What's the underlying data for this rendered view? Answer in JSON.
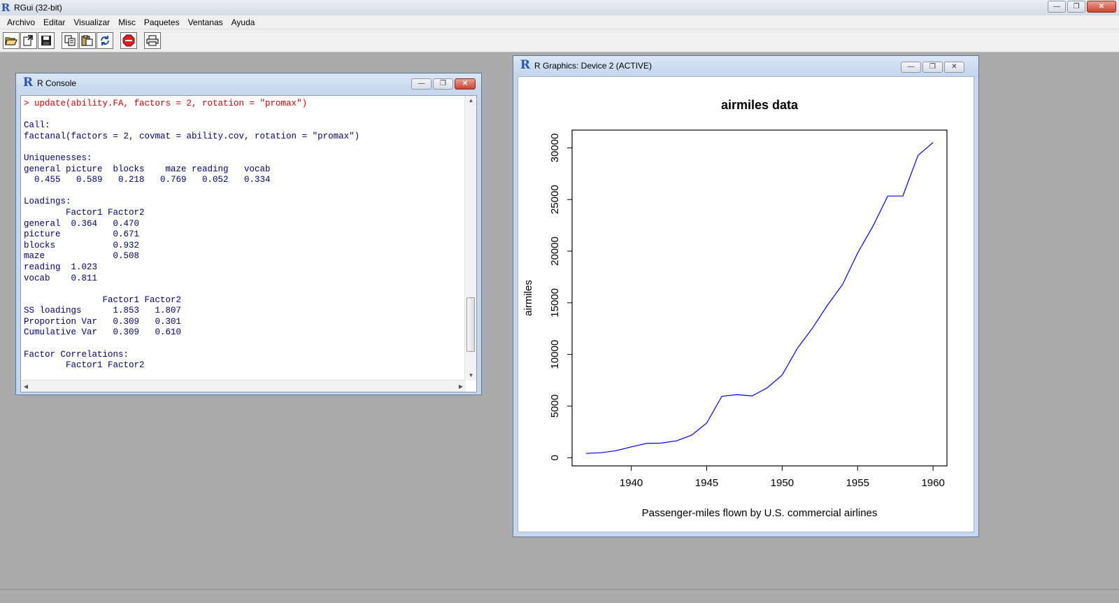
{
  "app": {
    "title": "RGui (32-bit)",
    "window_controls": {
      "minimize": "—",
      "restore": "❐",
      "close": "✕"
    }
  },
  "menu": [
    "Archivo",
    "Editar",
    "Visualizar",
    "Misc",
    "Paquetes",
    "Ventanas",
    "Ayuda"
  ],
  "toolbar": {
    "icons": [
      "open-script-icon",
      "load-workspace-icon",
      "save-workspace-icon",
      "copy-icon",
      "paste-icon",
      "copy-paste-icon",
      "stop-icon",
      "print-icon"
    ]
  },
  "console": {
    "title": "R Console",
    "command": "> update(ability.FA, factors = 2, rotation = \"promax\")",
    "lines": [
      "",
      "Call:",
      "factanal(factors = 2, covmat = ability.cov, rotation = \"promax\")",
      "",
      "Uniquenesses:",
      "general picture  blocks    maze reading   vocab ",
      "  0.455   0.589   0.218   0.769   0.052   0.334 ",
      "",
      "Loadings:",
      "        Factor1 Factor2",
      "general  0.364   0.470 ",
      "picture          0.671 ",
      "blocks           0.932 ",
      "maze             0.508 ",
      "reading  1.023         ",
      "vocab    0.811         ",
      "",
      "               Factor1 Factor2",
      "SS loadings      1.853   1.807",
      "Proportion Var   0.309   0.301",
      "Cumulative Var   0.309   0.610",
      "",
      "Factor Correlations:",
      "        Factor1 Factor2"
    ]
  },
  "graphics": {
    "title": "R Graphics: Device 2 (ACTIVE)"
  },
  "chart_data": {
    "type": "line",
    "title": "airmiles data",
    "xlabel": "Passenger-miles flown by U.S. commercial airlines",
    "ylabel": "airmiles",
    "x": [
      1937,
      1938,
      1939,
      1940,
      1941,
      1942,
      1943,
      1944,
      1945,
      1946,
      1947,
      1948,
      1949,
      1950,
      1951,
      1952,
      1953,
      1954,
      1955,
      1956,
      1957,
      1958,
      1959,
      1960
    ],
    "series": [
      {
        "values": [
          412,
          480,
          683,
          1052,
          1385,
          1418,
          1634,
          2178,
          3362,
          5948,
          6109,
          5981,
          6753,
          8003,
          10566,
          12528,
          14760,
          16769,
          19819,
          22362,
          25340,
          25343,
          29269,
          30514
        ],
        "color": "#0000ff"
      }
    ],
    "xticks": [
      1940,
      1945,
      1950,
      1955,
      1960
    ],
    "yticks": [
      0,
      5000,
      10000,
      15000,
      20000,
      25000,
      30000
    ],
    "xlim": [
      1937,
      1960
    ],
    "ylim": [
      412,
      30514
    ],
    "grid": false
  }
}
